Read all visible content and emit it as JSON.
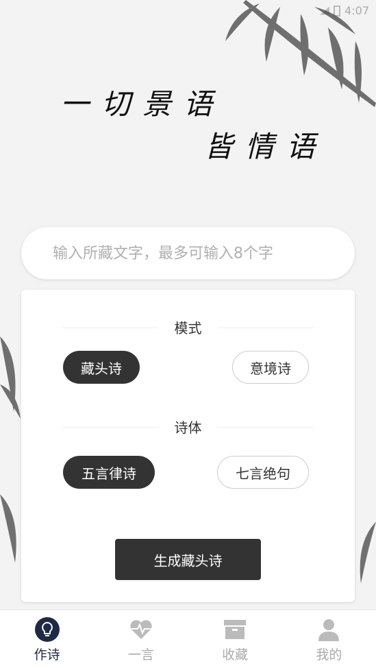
{
  "status": {
    "time": "4:07"
  },
  "hero": {
    "line1": "一切景语",
    "line2": "皆情语"
  },
  "input": {
    "placeholder": "输入所藏文字，最多可输入8个字",
    "value": ""
  },
  "mode": {
    "title": "模式",
    "options": [
      "藏头诗",
      "意境诗"
    ],
    "selected": "藏头诗"
  },
  "form": {
    "title": "诗体",
    "options": [
      "五言律诗",
      "七言绝句"
    ],
    "selected": "五言律诗"
  },
  "generate_label": "生成藏头诗",
  "tabs": [
    {
      "label": "作诗",
      "icon": "lightbulb-icon",
      "active": true
    },
    {
      "label": "一言",
      "icon": "heart-pulse-icon",
      "active": false
    },
    {
      "label": "收藏",
      "icon": "box-icon",
      "active": false
    },
    {
      "label": "我的",
      "icon": "user-icon",
      "active": false
    }
  ],
  "colors": {
    "accent": "#1e2a44",
    "dark": "#333333",
    "inactive": "#aaaaaa"
  }
}
